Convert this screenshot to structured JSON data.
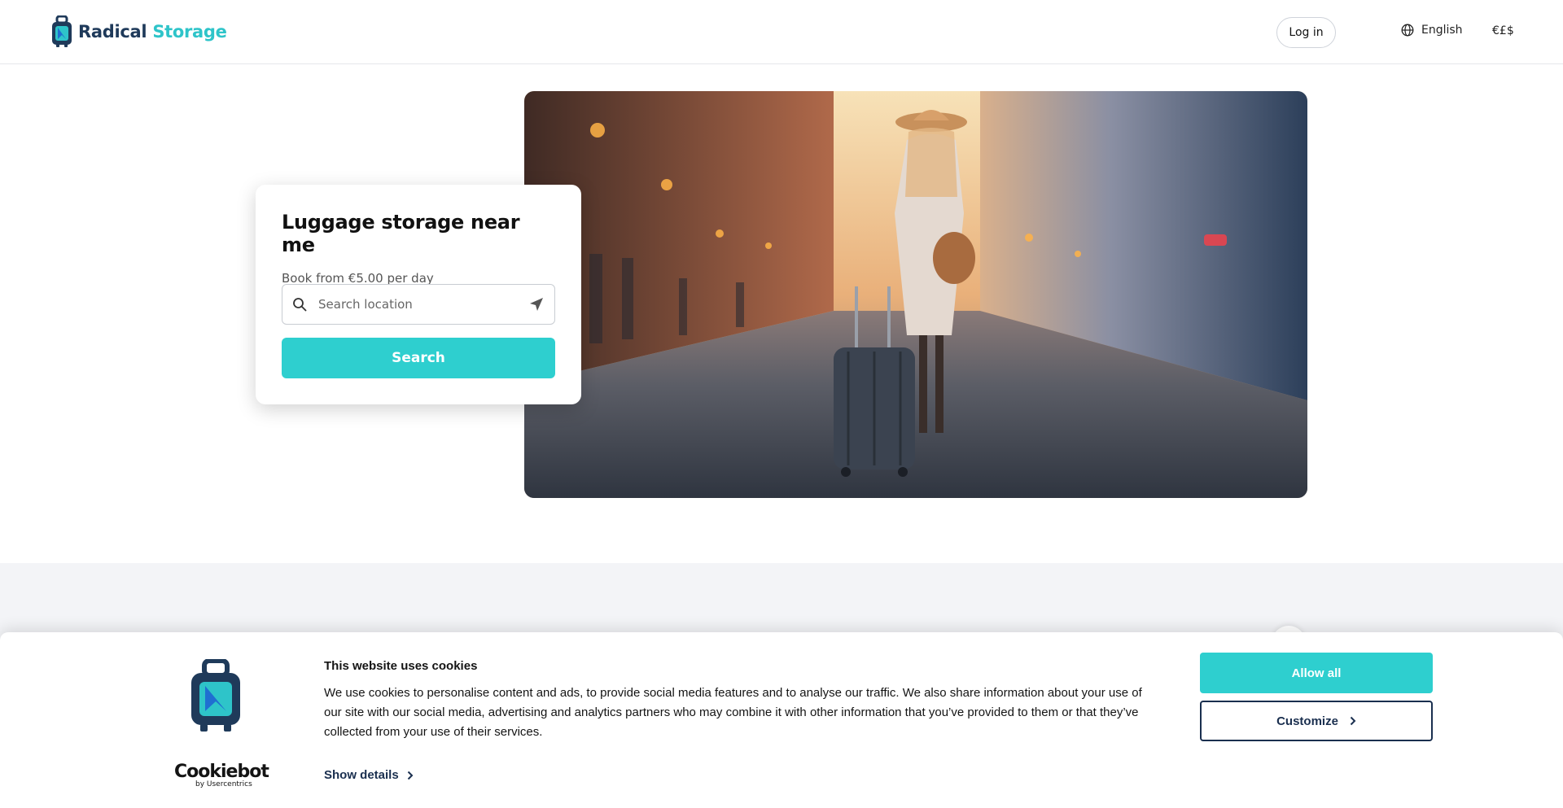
{
  "header": {
    "logo_part1": "Radical",
    "logo_part2": "Storage",
    "login_label": "Log in",
    "language_label": "English",
    "currency_label": "€£$"
  },
  "hero": {
    "title": "Luggage storage near me",
    "subtitle": "Book from €5.00 per day",
    "search_placeholder": "Search location",
    "search_button": "Search"
  },
  "cookie_banner": {
    "title": "This website uses cookies",
    "body": "We use cookies to personalise content and ads, to provide social media features and to analyse our traffic. We also share information about your use of our site with our social media, advertising and analytics partners who may combine it with other information that you’ve provided to them or that they’ve collected from your use of their services.",
    "show_details": "Show details",
    "allow_all": "Allow all",
    "customize": "Customize",
    "brand_main": "Cookiebot",
    "brand_sub": "by Usercentrics"
  },
  "colors": {
    "accent": "#2ecfcf",
    "brand_dark": "#1f3a5a",
    "section_bg": "#f3f4f7"
  }
}
